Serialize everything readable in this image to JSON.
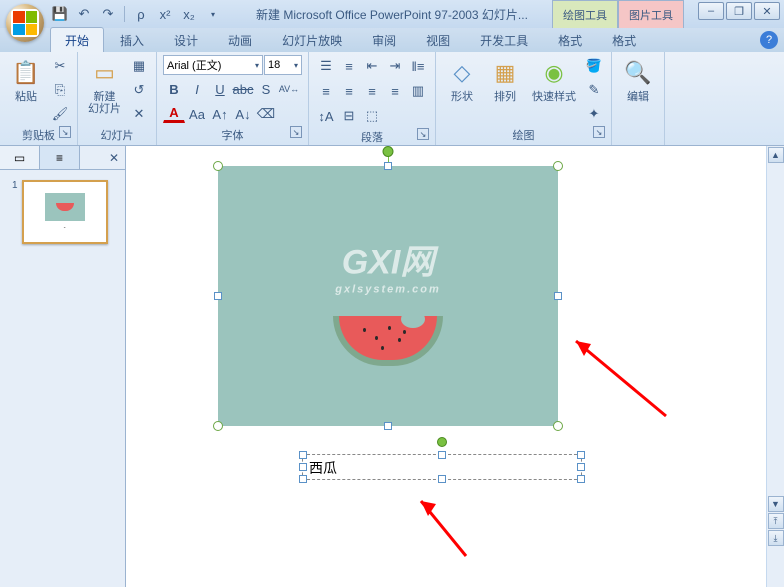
{
  "title": "新建 Microsoft Office PowerPoint 97-2003 幻灯片...",
  "context_tabs": {
    "drawing": "绘图工具",
    "picture": "图片工具"
  },
  "tabs": [
    "开始",
    "插入",
    "设计",
    "动画",
    "幻灯片放映",
    "审阅",
    "视图",
    "开发工具",
    "格式",
    "格式"
  ],
  "active_tab": 0,
  "groups": {
    "clipboard": {
      "label": "剪贴板",
      "paste": "粘贴"
    },
    "slides": {
      "label": "幻灯片",
      "new_slide": "新建\n幻灯片"
    },
    "font": {
      "label": "字体",
      "name": "Arial (正文)",
      "size": "18"
    },
    "paragraph": {
      "label": "段落"
    },
    "drawing": {
      "label": "绘图",
      "shapes": "形状",
      "arrange": "排列",
      "quick": "快速样式"
    },
    "editing": {
      "label": "编辑"
    }
  },
  "slide_number": "1",
  "textbox_value": "西瓜",
  "watermark": {
    "main": "GXI网",
    "sub": "gxlsystem.com"
  }
}
